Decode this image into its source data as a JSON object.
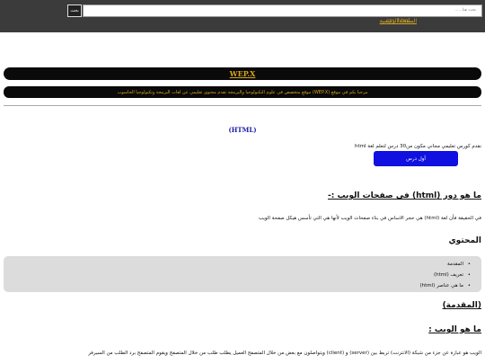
{
  "header": {
    "search_placeholder": "بحث هنا......",
    "search_button": "بحث",
    "nav_home": "الصفحة الرئيسية",
    "nav_links": [
      "html",
      "css"
    ]
  },
  "banner": {
    "brand": "WEP.X",
    "welcome": "مرحبا بكم في موقع (WEP.X) موقع متخصص في علوم التكنولوجيا والبرمجة تقدم محتوى تعليمي عن لغات البرمجة وتكنولوجيا الحاسوب"
  },
  "course": {
    "title": "(HTML)",
    "intro": "نقدم كورس تعليمي مجاني مكون من30 درس لتعلم لغة html",
    "first_lesson_button": "أول درس"
  },
  "section_role": {
    "heading": "ما هو دور (html) في صفحات الويب :-",
    "text": "في الحقيقة فأن لغة (html) هي حجر الاساس في بناء صفحات الويب لأنها هي التي تأسس هيكل صفحة الويب"
  },
  "contents": {
    "heading": "المحتوي",
    "items": [
      "المقدمة",
      "تعريف (html)",
      "ما هي عناصر (html)"
    ]
  },
  "section_intro": {
    "heading": "(المقدمة)"
  },
  "section_web": {
    "heading": "ما هو الويب :",
    "text": "الويب هو عبارة عن جزء من شبكة (الانترنت) تربط بين (server) و (client) ويتواصلون مع بعض من خلال المتصفح العميل يطلب طلب من خلال المتصفح ويقوم المتصفح برد الطلب من السيرفر"
  }
}
